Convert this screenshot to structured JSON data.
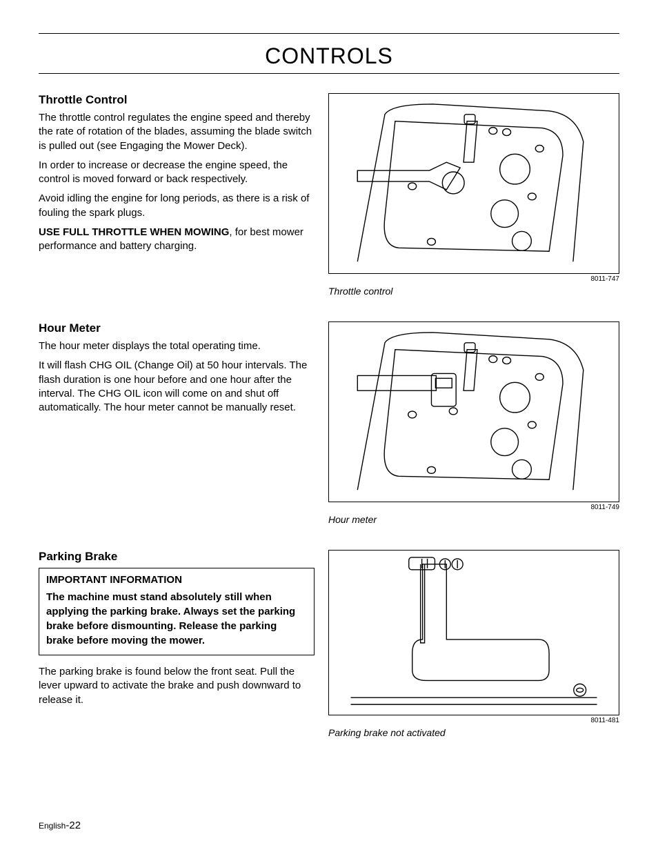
{
  "page_title": "CONTROLS",
  "sections": {
    "throttle": {
      "heading": "Throttle Control",
      "p1": "The throttle control regulates the engine speed and thereby the rate of rotation of the blades, assuming the blade switch is pulled out (see Engaging the Mower Deck).",
      "p2": "In order to increase or decrease the engine speed, the control is moved forward or back respectively.",
      "p3": "Avoid idling the engine for long periods, as there is a risk of fouling the spark plugs.",
      "p4_strong": "USE FULL THROTTLE WHEN MOWING",
      "p4_rest": ", for best mower performance and battery charging.",
      "fig_id": "8011-747",
      "fig_caption": "Throttle control"
    },
    "hour": {
      "heading": "Hour Meter",
      "p1": "The hour meter displays the total operating time.",
      "p2": "It will flash CHG OIL (Change Oil) at 50 hour intervals. The flash duration is one hour before and one hour after the interval. The CHG OIL icon will come on and shut off automatically. The hour meter cannot be manually reset.",
      "fig_id": "8011-749",
      "fig_caption": "Hour meter"
    },
    "brake": {
      "heading": "Parking Brake",
      "important_title": "IMPORTANT INFORMATION",
      "important_body": "The machine must stand absolutely still when applying the parking brake. Always set the parking brake before dismounting. Release the parking brake before moving the mower.",
      "p1": "The parking brake is found below the front seat. Pull the lever upward to activate the brake and push downward to release it.",
      "fig_id": "8011-481",
      "fig_caption": "Parking brake not activated"
    }
  },
  "footer": {
    "lang": "English",
    "page": "-22"
  }
}
